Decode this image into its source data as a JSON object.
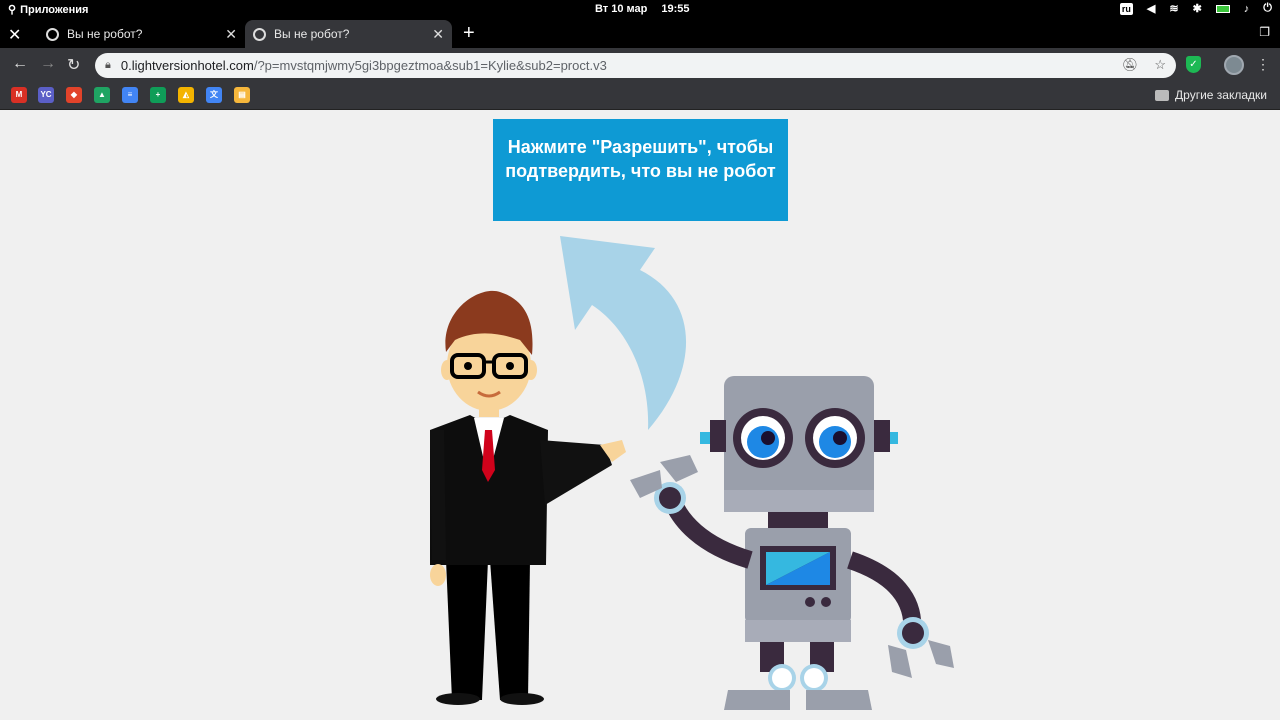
{
  "system": {
    "apps_label": "Приложения",
    "date": "Вт 10 мар",
    "time": "19:55",
    "lang": "ru"
  },
  "tabs": [
    {
      "title": "Вы не робот?"
    },
    {
      "title": "Вы не робот?"
    }
  ],
  "address": {
    "host": "0.lightversionhotel.com",
    "path": "/?p=mvstqmjwmy5gi3bpgeztmoa&sub1=Kylie&sub2=proct.v3"
  },
  "bookmarks": {
    "items": [
      "gmail-icon",
      "yc-icon",
      "gitlab-icon",
      "drive-icon",
      "docs-icon",
      "sheets-icon",
      "slides-icon",
      "translate-icon",
      "bookmark-icon"
    ],
    "yc_label": "YC",
    "other_label": "Другие закладки"
  },
  "page": {
    "banner_text": "Нажмите \"Разрешить\", чтобы подтвердить, что вы не робот"
  },
  "colors": {
    "banner": "#0e9ad4",
    "arrow": "#a8d3e8",
    "robot": "#9a9fab"
  }
}
